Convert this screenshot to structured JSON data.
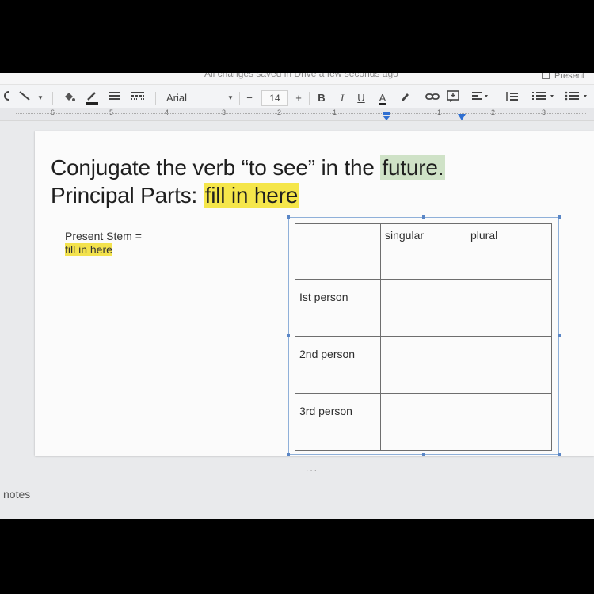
{
  "header": {
    "saved_status": "All changes saved in Drive a few seconds ago",
    "present_label": "Present"
  },
  "toolbar": {
    "font_name": "Arial",
    "font_size": "14",
    "minus": "−",
    "plus": "+",
    "bold": "B",
    "italic": "I",
    "underline": "U",
    "text_color": "A"
  },
  "ruler": {
    "labels": [
      "6",
      "5",
      "4",
      "3",
      "2",
      "1",
      "1",
      "2",
      "3"
    ]
  },
  "slide": {
    "title_prefix": "Conjugate the verb “to see” in the ",
    "title_highlight": "future.",
    "subtitle_prefix": "Principal Parts: ",
    "subtitle_highlight": "fill in here",
    "present_stem_label": "Present Stem =",
    "present_stem_value": "fill in here"
  },
  "table": {
    "headers": [
      "",
      "singular",
      "plural"
    ],
    "rows": [
      {
        "label": "Ist person",
        "singular": "",
        "plural": ""
      },
      {
        "label": "2nd person",
        "singular": "",
        "plural": ""
      },
      {
        "label": "3rd person",
        "singular": "",
        "plural": ""
      }
    ]
  },
  "notes_label": "notes",
  "colors": {
    "highlight_yellow": "#f5e64a",
    "highlight_green": "#cfe2c7",
    "selection_blue": "#5a86c6"
  }
}
